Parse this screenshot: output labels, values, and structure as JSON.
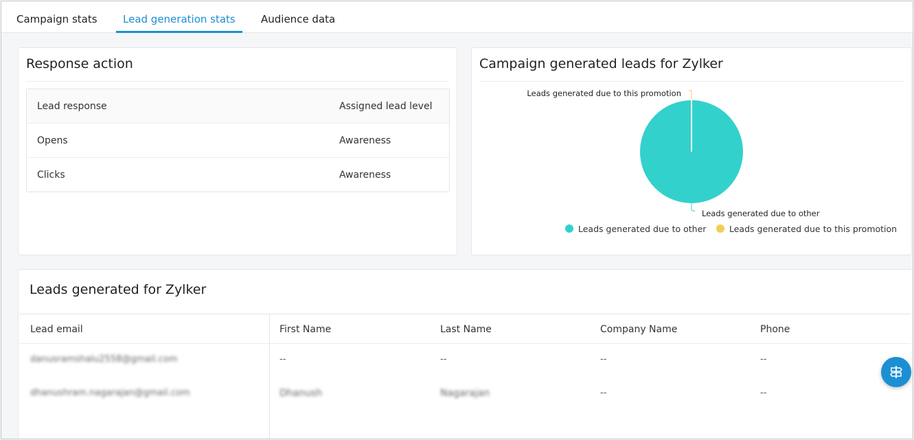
{
  "tabs": [
    {
      "label": "Campaign stats"
    },
    {
      "label": "Lead generation stats"
    },
    {
      "label": "Audience data"
    }
  ],
  "response_action": {
    "title": "Response action",
    "headers": [
      "Lead response",
      "Assigned lead level"
    ],
    "rows": [
      [
        "Opens",
        "Awareness"
      ],
      [
        "Clicks",
        "Awareness"
      ]
    ]
  },
  "campaign_leads": {
    "title": "Campaign generated leads for Zylker"
  },
  "chart_data": {
    "type": "pie",
    "title": "Campaign generated leads for Zylker",
    "categories": [
      "Leads generated due to other",
      "Leads generated due to this promotion"
    ],
    "values": [
      100,
      0
    ],
    "colors": [
      "#33d1cc",
      "#f2cc55"
    ],
    "legend": "bottom-center"
  },
  "leads_generated": {
    "title": "Leads generated for Zylker",
    "headers": [
      "Lead email",
      "First Name",
      "Last Name",
      "Company Name",
      "Phone"
    ],
    "rows": [
      [
        "danusramshalu2558@gmail.com",
        "--",
        "--",
        "--",
        "--"
      ],
      [
        "dhanushram.nagarajan@gmail.com",
        "Dhanush",
        "Nagarajan",
        "--",
        "--"
      ]
    ]
  },
  "colors": {
    "accent": "#1b8fd3",
    "pie_other": "#33d1cc",
    "pie_promotion": "#f2cc55"
  },
  "fab": {
    "icon": "signpost-icon"
  }
}
